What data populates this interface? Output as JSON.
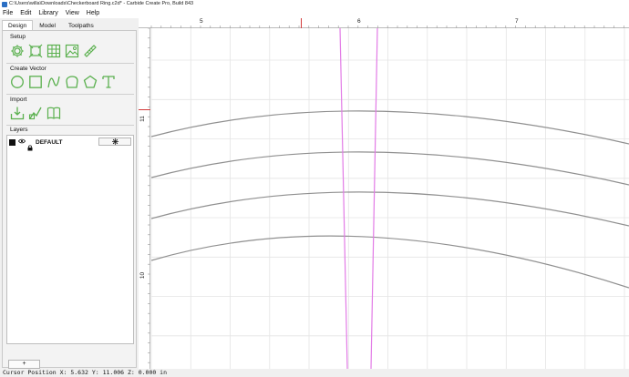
{
  "window": {
    "title": "C:\\Users\\willa\\Downloads\\Checkerboard Ring.c2d* - Carbide Create Pro, Build 843"
  },
  "menu": [
    {
      "label": "File"
    },
    {
      "label": "Edit"
    },
    {
      "label": "Library"
    },
    {
      "label": "View"
    },
    {
      "label": "Help"
    }
  ],
  "tabs": [
    {
      "label": "Design",
      "active": true
    },
    {
      "label": "Model",
      "active": false
    },
    {
      "label": "Toolpaths",
      "active": false
    }
  ],
  "sections": {
    "setup": "Setup",
    "create_vector": "Create Vector",
    "import": "Import",
    "layers": "Layers"
  },
  "icons": {
    "setup": [
      "settings-gear-icon",
      "design-size-icon",
      "grid-icon",
      "image-icon",
      "measure-icon"
    ],
    "create_vector": [
      "circle-icon",
      "rectangle-icon",
      "curve-icon",
      "polygon-icon",
      "pentagon-icon",
      "text-icon"
    ],
    "import": [
      "import-icon",
      "import-vector-icon",
      "book-icon"
    ]
  },
  "layers": {
    "items": [
      {
        "name": "DEFAULT",
        "visible": true,
        "locked": true,
        "color": "#111111"
      }
    ],
    "add_label": "+"
  },
  "rulers": {
    "top_labels": [
      "5",
      "6",
      "7"
    ],
    "left_labels": [
      "11",
      "10"
    ]
  },
  "status": {
    "cursor_text": "Cursor Position X: 5.632 Y: 11.006 Z: 0.000 in"
  },
  "colors": {
    "accent_green": "#5ab04e",
    "vector_magenta": "#e27be6",
    "curve_gray": "#909090",
    "cursor_marker": "#d23a3a"
  }
}
